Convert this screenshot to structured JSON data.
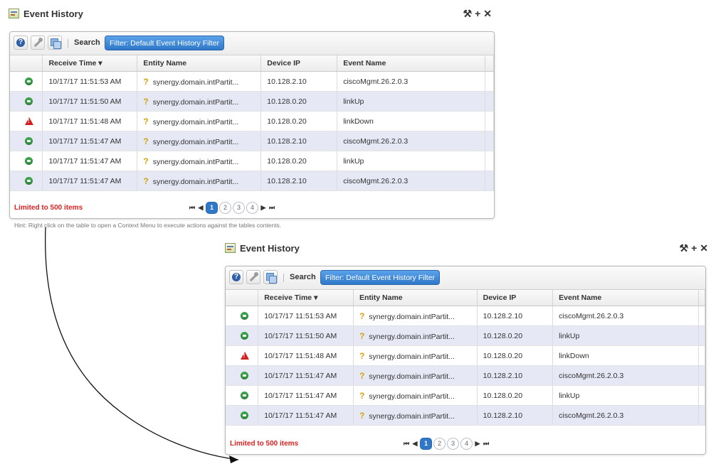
{
  "portlet": {
    "title": "Event History",
    "tools": [
      "⚒",
      "+",
      "✕"
    ],
    "toolbar": {
      "search_label": "Search",
      "filter_label": "Filter: Default Event History Filter"
    },
    "columns": [
      "Receive Time ▾",
      "Entity Name",
      "Device IP",
      "Event Name"
    ],
    "rows": [
      {
        "severity": "normal",
        "time": "10/17/17 11:51:53 AM",
        "entity": "synergy.domain.intPartit...",
        "ip": "10.128.2.10",
        "event": "ciscoMgmt.26.2.0.3"
      },
      {
        "severity": "normal",
        "time": "10/17/17 11:51:50 AM",
        "entity": "synergy.domain.intPartit...",
        "ip": "10.128.0.20",
        "event": "linkUp"
      },
      {
        "severity": "critical",
        "time": "10/17/17 11:51:48 AM",
        "entity": "synergy.domain.intPartit...",
        "ip": "10.128.0.20",
        "event": "linkDown"
      },
      {
        "severity": "normal",
        "time": "10/17/17 11:51:47 AM",
        "entity": "synergy.domain.intPartit...",
        "ip": "10.128.2.10",
        "event": "ciscoMgmt.26.2.0.3"
      },
      {
        "severity": "normal",
        "time": "10/17/17 11:51:47 AM",
        "entity": "synergy.domain.intPartit...",
        "ip": "10.128.0.20",
        "event": "linkUp"
      },
      {
        "severity": "normal",
        "time": "10/17/17 11:51:47 AM",
        "entity": "synergy.domain.intPartit...",
        "ip": "10.128.2.10",
        "event": "ciscoMgmt.26.2.0.3"
      }
    ],
    "limited_text": "Limited to 500 items",
    "pager": {
      "first": "⏮",
      "prev": "◀",
      "pages": [
        "1",
        "2",
        "3",
        "4"
      ],
      "current": "1",
      "next": "▶",
      "last": "⏭"
    }
  },
  "hint": "Hint: Right click on the table to open a Context Menu to execute actions against the tables contents.",
  "colors": {
    "accent": "#2f78c9",
    "alt_row": "#e6e8f5",
    "limited": "#dd2222",
    "ok": "#3aa34a",
    "critical": "#d11f1f"
  }
}
